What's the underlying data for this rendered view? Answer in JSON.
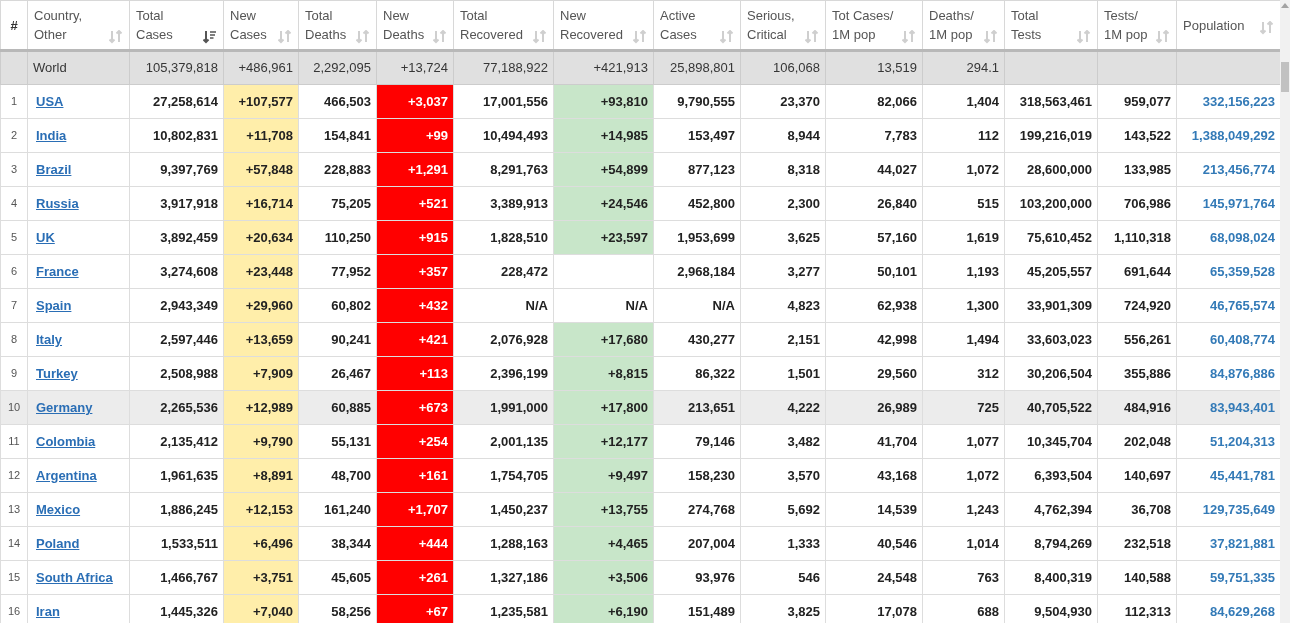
{
  "table": {
    "columns": [
      {
        "lines": [
          "#"
        ]
      },
      {
        "lines": [
          "Country,",
          "Other"
        ],
        "sorted": false
      },
      {
        "lines": [
          "Total",
          "Cases"
        ],
        "sorted": true
      },
      {
        "lines": [
          "New",
          "Cases"
        ],
        "sorted": false
      },
      {
        "lines": [
          "Total",
          "Deaths"
        ],
        "sorted": false
      },
      {
        "lines": [
          "New",
          "Deaths"
        ],
        "sorted": false
      },
      {
        "lines": [
          "Total",
          "Recovered"
        ],
        "sorted": false
      },
      {
        "lines": [
          "New",
          "Recovered"
        ],
        "sorted": false
      },
      {
        "lines": [
          "Active",
          "Cases"
        ],
        "sorted": false
      },
      {
        "lines": [
          "Serious,",
          "Critical"
        ],
        "sorted": false
      },
      {
        "lines": [
          "Tot Cases/",
          "1M pop"
        ],
        "sorted": false
      },
      {
        "lines": [
          "Deaths/",
          "1M pop"
        ],
        "sorted": false
      },
      {
        "lines": [
          "Total",
          "Tests"
        ],
        "sorted": false
      },
      {
        "lines": [
          "Tests/",
          "1M pop"
        ],
        "sorted": false
      },
      {
        "lines": [
          "Population"
        ],
        "sorted": false
      }
    ],
    "world": {
      "country": "World",
      "total_cases": "105,379,818",
      "new_cases": "+486,961",
      "total_deaths": "2,292,095",
      "new_deaths": "+13,724",
      "total_recovered": "77,188,922",
      "new_recovered": "+421,913",
      "active_cases": "25,898,801",
      "serious": "106,068",
      "cases_per_1m": "13,519",
      "deaths_per_1m": "294.1"
    },
    "rows": [
      {
        "rank": "1",
        "country": "USA",
        "total_cases": "27,258,614",
        "new_cases": "+107,577",
        "total_deaths": "466,503",
        "new_deaths": "+3,037",
        "total_recovered": "17,001,556",
        "new_recovered": "+93,810",
        "new_recovered_filled": true,
        "active_cases": "9,790,555",
        "serious": "23,370",
        "cases_per_1m": "82,066",
        "deaths_per_1m": "1,404",
        "total_tests": "318,563,461",
        "tests_per_1m": "959,077",
        "population": "332,156,223",
        "hovered": false
      },
      {
        "rank": "2",
        "country": "India",
        "total_cases": "10,802,831",
        "new_cases": "+11,708",
        "total_deaths": "154,841",
        "new_deaths": "+99",
        "total_recovered": "10,494,493",
        "new_recovered": "+14,985",
        "new_recovered_filled": true,
        "active_cases": "153,497",
        "serious": "8,944",
        "cases_per_1m": "7,783",
        "deaths_per_1m": "112",
        "total_tests": "199,216,019",
        "tests_per_1m": "143,522",
        "population": "1,388,049,292",
        "hovered": false
      },
      {
        "rank": "3",
        "country": "Brazil",
        "total_cases": "9,397,769",
        "new_cases": "+57,848",
        "total_deaths": "228,883",
        "new_deaths": "+1,291",
        "total_recovered": "8,291,763",
        "new_recovered": "+54,899",
        "new_recovered_filled": true,
        "active_cases": "877,123",
        "serious": "8,318",
        "cases_per_1m": "44,027",
        "deaths_per_1m": "1,072",
        "total_tests": "28,600,000",
        "tests_per_1m": "133,985",
        "population": "213,456,774",
        "hovered": false
      },
      {
        "rank": "4",
        "country": "Russia",
        "total_cases": "3,917,918",
        "new_cases": "+16,714",
        "total_deaths": "75,205",
        "new_deaths": "+521",
        "total_recovered": "3,389,913",
        "new_recovered": "+24,546",
        "new_recovered_filled": true,
        "active_cases": "452,800",
        "serious": "2,300",
        "cases_per_1m": "26,840",
        "deaths_per_1m": "515",
        "total_tests": "103,200,000",
        "tests_per_1m": "706,986",
        "population": "145,971,764",
        "hovered": false
      },
      {
        "rank": "5",
        "country": "UK",
        "total_cases": "3,892,459",
        "new_cases": "+20,634",
        "total_deaths": "110,250",
        "new_deaths": "+915",
        "total_recovered": "1,828,510",
        "new_recovered": "+23,597",
        "new_recovered_filled": true,
        "active_cases": "1,953,699",
        "serious": "3,625",
        "cases_per_1m": "57,160",
        "deaths_per_1m": "1,619",
        "total_tests": "75,610,452",
        "tests_per_1m": "1,110,318",
        "population": "68,098,024",
        "hovered": false
      },
      {
        "rank": "6",
        "country": "France",
        "total_cases": "3,274,608",
        "new_cases": "+23,448",
        "total_deaths": "77,952",
        "new_deaths": "+357",
        "total_recovered": "228,472",
        "active_cases": "2,968,184",
        "serious": "3,277",
        "cases_per_1m": "50,101",
        "deaths_per_1m": "1,193",
        "total_tests": "45,205,557",
        "tests_per_1m": "691,644",
        "population": "65,359,528",
        "hovered": false
      },
      {
        "rank": "7",
        "country": "Spain",
        "total_cases": "2,943,349",
        "new_cases": "+29,960",
        "total_deaths": "60,802",
        "new_deaths": "+432",
        "total_recovered": "N/A",
        "new_recovered": "N/A",
        "new_recovered_filled": false,
        "active_cases": "N/A",
        "serious": "4,823",
        "cases_per_1m": "62,938",
        "deaths_per_1m": "1,300",
        "total_tests": "33,901,309",
        "tests_per_1m": "724,920",
        "population": "46,765,574",
        "hovered": false
      },
      {
        "rank": "8",
        "country": "Italy",
        "total_cases": "2,597,446",
        "new_cases": "+13,659",
        "total_deaths": "90,241",
        "new_deaths": "+421",
        "total_recovered": "2,076,928",
        "new_recovered": "+17,680",
        "new_recovered_filled": true,
        "active_cases": "430,277",
        "serious": "2,151",
        "cases_per_1m": "42,998",
        "deaths_per_1m": "1,494",
        "total_tests": "33,603,023",
        "tests_per_1m": "556,261",
        "population": "60,408,774",
        "hovered": false
      },
      {
        "rank": "9",
        "country": "Turkey",
        "total_cases": "2,508,988",
        "new_cases": "+7,909",
        "total_deaths": "26,467",
        "new_deaths": "+113",
        "total_recovered": "2,396,199",
        "new_recovered": "+8,815",
        "new_recovered_filled": true,
        "active_cases": "86,322",
        "serious": "1,501",
        "cases_per_1m": "29,560",
        "deaths_per_1m": "312",
        "total_tests": "30,206,504",
        "tests_per_1m": "355,886",
        "population": "84,876,886",
        "hovered": false
      },
      {
        "rank": "10",
        "country": "Germany",
        "total_cases": "2,265,536",
        "new_cases": "+12,989",
        "total_deaths": "60,885",
        "new_deaths": "+673",
        "total_recovered": "1,991,000",
        "new_recovered": "+17,800",
        "new_recovered_filled": true,
        "active_cases": "213,651",
        "serious": "4,222",
        "cases_per_1m": "26,989",
        "deaths_per_1m": "725",
        "total_tests": "40,705,522",
        "tests_per_1m": "484,916",
        "population": "83,943,401",
        "hovered": true
      },
      {
        "rank": "11",
        "country": "Colombia",
        "total_cases": "2,135,412",
        "new_cases": "+9,790",
        "total_deaths": "55,131",
        "new_deaths": "+254",
        "total_recovered": "2,001,135",
        "new_recovered": "+12,177",
        "new_recovered_filled": true,
        "active_cases": "79,146",
        "serious": "3,482",
        "cases_per_1m": "41,704",
        "deaths_per_1m": "1,077",
        "total_tests": "10,345,704",
        "tests_per_1m": "202,048",
        "population": "51,204,313",
        "hovered": false
      },
      {
        "rank": "12",
        "country": "Argentina",
        "total_cases": "1,961,635",
        "new_cases": "+8,891",
        "total_deaths": "48,700",
        "new_deaths": "+161",
        "total_recovered": "1,754,705",
        "new_recovered": "+9,497",
        "new_recovered_filled": true,
        "active_cases": "158,230",
        "serious": "3,570",
        "cases_per_1m": "43,168",
        "deaths_per_1m": "1,072",
        "total_tests": "6,393,504",
        "tests_per_1m": "140,697",
        "population": "45,441,781",
        "hovered": false
      },
      {
        "rank": "13",
        "country": "Mexico",
        "total_cases": "1,886,245",
        "new_cases": "+12,153",
        "total_deaths": "161,240",
        "new_deaths": "+1,707",
        "total_recovered": "1,450,237",
        "new_recovered": "+13,755",
        "new_recovered_filled": true,
        "active_cases": "274,768",
        "serious": "5,692",
        "cases_per_1m": "14,539",
        "deaths_per_1m": "1,243",
        "total_tests": "4,762,394",
        "tests_per_1m": "36,708",
        "population": "129,735,649",
        "hovered": false
      },
      {
        "rank": "14",
        "country": "Poland",
        "total_cases": "1,533,511",
        "new_cases": "+6,496",
        "total_deaths": "38,344",
        "new_deaths": "+444",
        "total_recovered": "1,288,163",
        "new_recovered": "+4,465",
        "new_recovered_filled": true,
        "active_cases": "207,004",
        "serious": "1,333",
        "cases_per_1m": "40,546",
        "deaths_per_1m": "1,014",
        "total_tests": "8,794,269",
        "tests_per_1m": "232,518",
        "population": "37,821,881",
        "hovered": false
      },
      {
        "rank": "15",
        "country": "South Africa",
        "total_cases": "1,466,767",
        "new_cases": "+3,751",
        "total_deaths": "45,605",
        "new_deaths": "+261",
        "total_recovered": "1,327,186",
        "new_recovered": "+3,506",
        "new_recovered_filled": true,
        "active_cases": "93,976",
        "serious": "546",
        "cases_per_1m": "24,548",
        "deaths_per_1m": "763",
        "total_tests": "8,400,319",
        "tests_per_1m": "140,588",
        "population": "59,751,335",
        "hovered": false
      },
      {
        "rank": "16",
        "country": "Iran",
        "total_cases": "1,445,326",
        "new_cases": "+7,040",
        "total_deaths": "58,256",
        "new_deaths": "+67",
        "total_recovered": "1,235,581",
        "new_recovered": "+6,190",
        "new_recovered_filled": true,
        "active_cases": "151,489",
        "serious": "3,825",
        "cases_per_1m": "17,078",
        "deaths_per_1m": "688",
        "total_tests": "9,504,930",
        "tests_per_1m": "112,313",
        "population": "84,629,268",
        "hovered": false
      }
    ]
  }
}
